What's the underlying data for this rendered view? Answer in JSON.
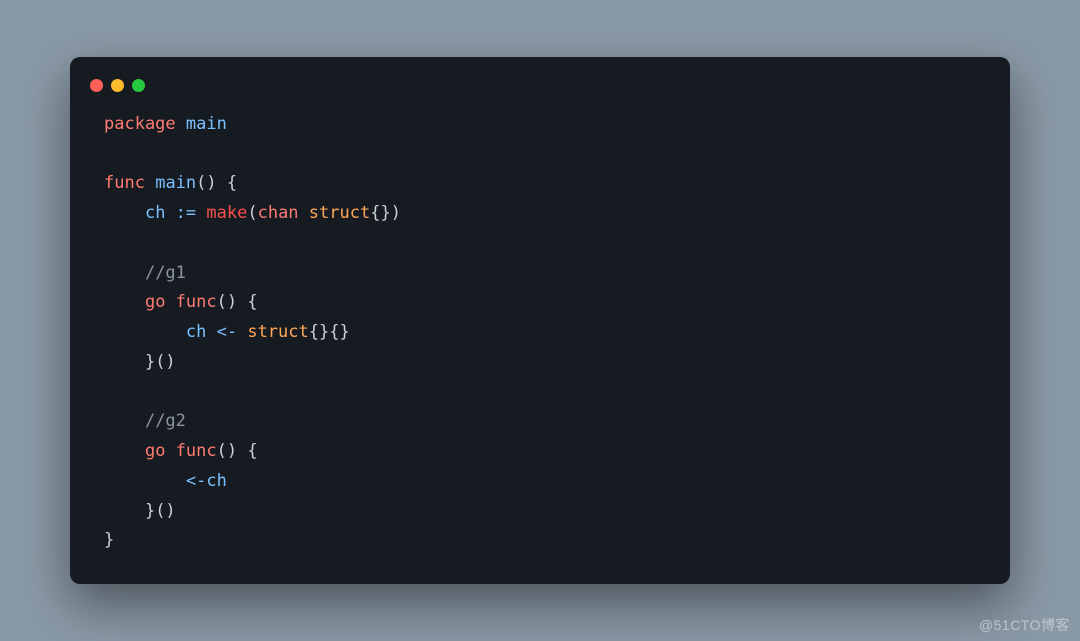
{
  "window": {
    "dots": [
      "red",
      "yellow",
      "green"
    ]
  },
  "code": {
    "l1": {
      "kw": "package",
      "id": "main"
    },
    "l2": "",
    "l3": {
      "kw": "func",
      "id": "main",
      "rest": "() {"
    },
    "l4": {
      "indent": "    ",
      "id": "ch",
      "op": " := ",
      "make": "make",
      "p1": "(",
      "kw": "chan",
      "sp": " ",
      "str": "struct",
      "p2": "{})"
    },
    "l5": "",
    "l6": {
      "indent": "    ",
      "com": "//g1"
    },
    "l7": {
      "indent": "    ",
      "kw": "go func",
      "rest": "() {"
    },
    "l8": {
      "indent": "        ",
      "id": "ch",
      "op": " <- ",
      "str": "struct",
      "rest": "{}{}"
    },
    "l9": {
      "indent": "    ",
      "rest": "}()"
    },
    "l10": "",
    "l11": {
      "indent": "    ",
      "com": "//g2"
    },
    "l12": {
      "indent": "    ",
      "kw": "go func",
      "rest": "() {"
    },
    "l13": {
      "indent": "        ",
      "op": "<-",
      "id": "ch"
    },
    "l14": {
      "indent": "    ",
      "rest": "}()"
    },
    "l15": {
      "rest": "}"
    }
  },
  "watermark": "@51CTO博客"
}
